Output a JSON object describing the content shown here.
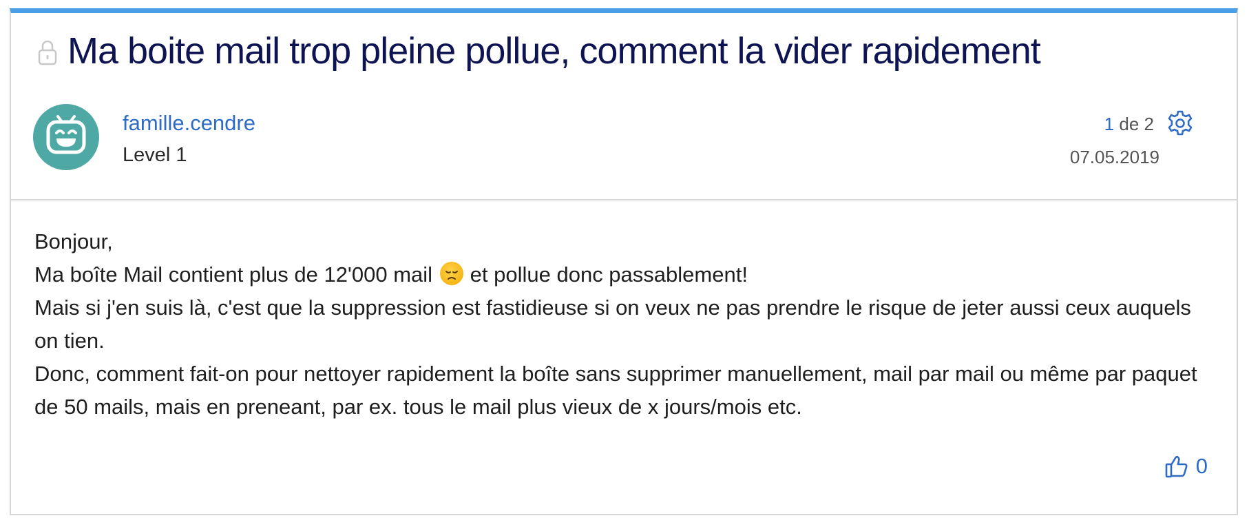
{
  "post": {
    "title": "Ma boite mail trop pleine pollue, comment la vider rapidement",
    "author": {
      "name": "famille.cendre",
      "level": "Level 1"
    },
    "pager": {
      "current": "1",
      "separator": "de",
      "total": "2"
    },
    "date": "07.05.2019",
    "body": {
      "line1": "Bonjour,",
      "line2a": "Ma boîte Mail contient plus de 12'000 mail",
      "line2_emoji": "disappointed-face-emoji",
      "line2b": "et pollue donc passablement!",
      "line3": "Mais si j'en suis là, c'est que la suppression est fastidieuse si on veux ne pas prendre le risque de jeter aussi ceux auquels on tien.",
      "line4": "Donc, comment fait-on pour nettoyer rapidement la boîte sans supprimer manuellement, mail par mail ou même par paquet de 50 mails, mais en preneant, par ex. tous le mail plus vieux de x jours/mois etc."
    },
    "likes": "0"
  },
  "colors": {
    "accent_bar": "#4a9fe6",
    "title": "#0e1452",
    "link": "#2d6bc4",
    "avatar_bg": "#4ea8a4"
  },
  "icons": {
    "lock": "lock-icon",
    "gear": "gear-icon",
    "like": "thumbs-up-icon",
    "avatar": "robot-avatar-icon"
  }
}
